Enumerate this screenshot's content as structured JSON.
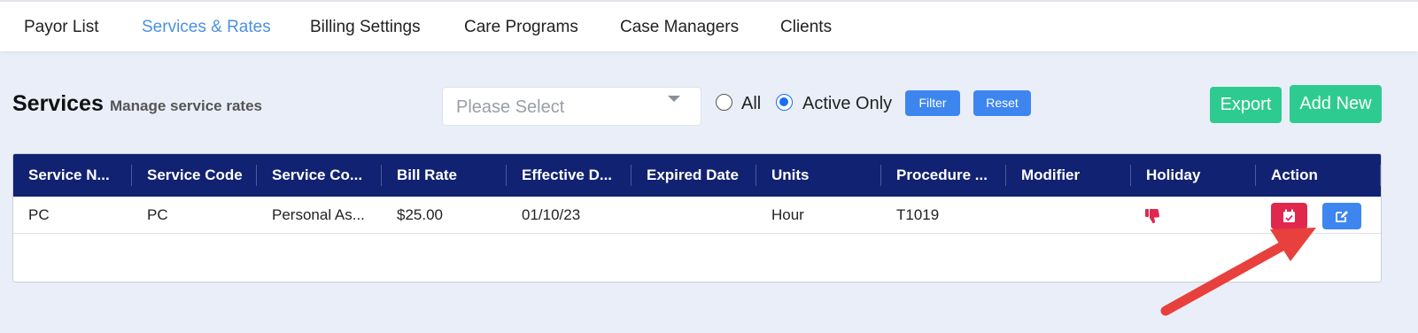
{
  "nav": {
    "tabs": [
      {
        "label": "Payor List"
      },
      {
        "label": "Services & Rates"
      },
      {
        "label": "Billing Settings"
      },
      {
        "label": "Care Programs"
      },
      {
        "label": "Case Managers"
      },
      {
        "label": "Clients"
      }
    ],
    "active_index": 1
  },
  "header": {
    "title": "Services",
    "subtitle": "Manage service rates"
  },
  "filters": {
    "select_placeholder": "Please Select",
    "radio_all_label": "All",
    "radio_active_label": "Active Only",
    "selected_radio": "Active Only",
    "filter_label": "Filter",
    "reset_label": "Reset"
  },
  "actions": {
    "export_label": "Export",
    "add_new_label": "Add New"
  },
  "table": {
    "columns": [
      "Service N...",
      "Service Code",
      "Service Co...",
      "Bill Rate",
      "Effective D...",
      "Expired Date",
      "Units",
      "Procedure ...",
      "Modifier",
      "Holiday",
      "Action"
    ],
    "rows": [
      {
        "service_name": "PC",
        "service_code": "PC",
        "service_category": "Personal As...",
        "bill_rate": "$25.00",
        "effective_date": "01/10/23",
        "expired_date": "",
        "units": "Hour",
        "procedure": "T1019",
        "modifier": "",
        "holiday_icon": "thumbs-down-icon",
        "action_icons": [
          "calendar-check-icon",
          "edit-icon"
        ]
      }
    ]
  },
  "colors": {
    "header_bg": "#122272",
    "active_tab": "#4a90e2",
    "primary_button": "#3d86f0",
    "success_button": "#2ecb90",
    "danger": "#e0284f",
    "arrow": "#e8403c"
  }
}
